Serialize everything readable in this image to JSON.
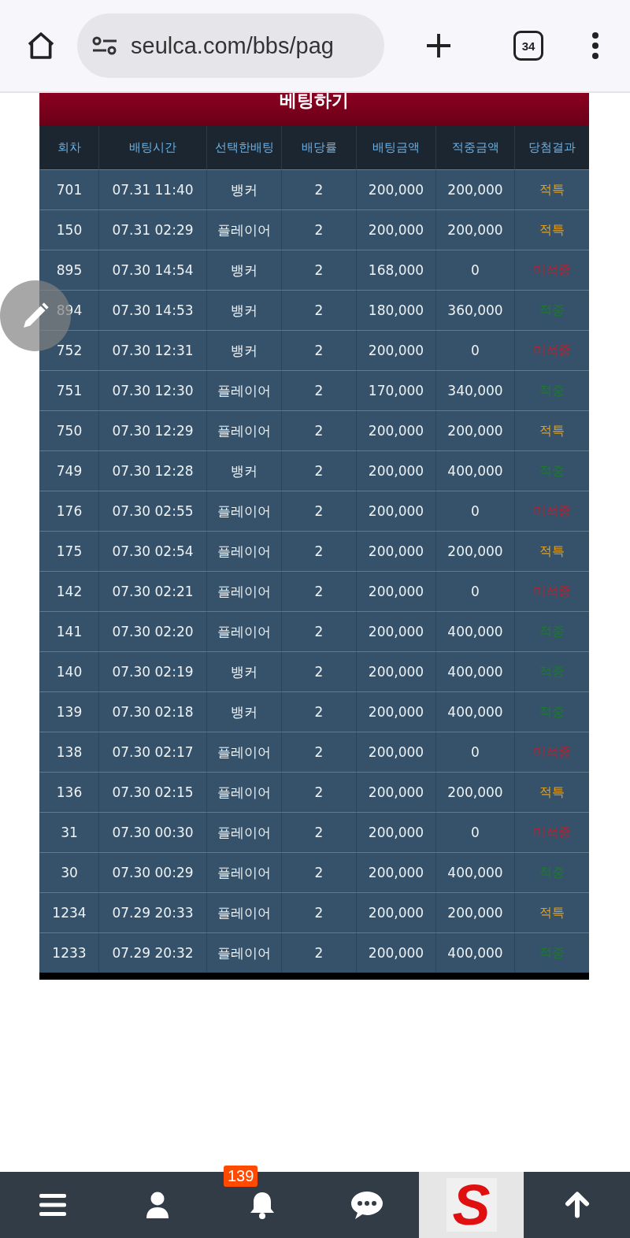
{
  "browser": {
    "url": "seulca.com/bbs/pag",
    "tab_count": "34"
  },
  "table": {
    "title": "베팅하기",
    "columns": [
      "회차",
      "배팅시간",
      "선택한배팅",
      "배당률",
      "배팅금액",
      "적중금액",
      "당첨결과"
    ],
    "rows": [
      {
        "round": "701",
        "time": "07.31 11:40",
        "pick": "뱅커",
        "odds": "2",
        "bet": "200,000",
        "payout": "200,000",
        "result": "적특",
        "color": "#e0a020"
      },
      {
        "round": "150",
        "time": "07.31 02:29",
        "pick": "플레이어",
        "odds": "2",
        "bet": "200,000",
        "payout": "200,000",
        "result": "적특",
        "color": "#e0a020"
      },
      {
        "round": "895",
        "time": "07.30 14:54",
        "pick": "뱅커",
        "odds": "2",
        "bet": "168,000",
        "payout": "0",
        "result": "미적중",
        "color": "#c01f2a"
      },
      {
        "round": "894",
        "time": "07.30 14:53",
        "pick": "뱅커",
        "odds": "2",
        "bet": "180,000",
        "payout": "360,000",
        "result": "적중",
        "color": "#1c7a2c"
      },
      {
        "round": "752",
        "time": "07.30 12:31",
        "pick": "뱅커",
        "odds": "2",
        "bet": "200,000",
        "payout": "0",
        "result": "미적중",
        "color": "#c01f2a"
      },
      {
        "round": "751",
        "time": "07.30 12:30",
        "pick": "플레이어",
        "odds": "2",
        "bet": "170,000",
        "payout": "340,000",
        "result": "적중",
        "color": "#1c7a2c"
      },
      {
        "round": "750",
        "time": "07.30 12:29",
        "pick": "플레이어",
        "odds": "2",
        "bet": "200,000",
        "payout": "200,000",
        "result": "적특",
        "color": "#e0a020"
      },
      {
        "round": "749",
        "time": "07.30 12:28",
        "pick": "뱅커",
        "odds": "2",
        "bet": "200,000",
        "payout": "400,000",
        "result": "적중",
        "color": "#1c7a2c"
      },
      {
        "round": "176",
        "time": "07.30 02:55",
        "pick": "플레이어",
        "odds": "2",
        "bet": "200,000",
        "payout": "0",
        "result": "미적중",
        "color": "#c01f2a"
      },
      {
        "round": "175",
        "time": "07.30 02:54",
        "pick": "플레이어",
        "odds": "2",
        "bet": "200,000",
        "payout": "200,000",
        "result": "적특",
        "color": "#e0a020"
      },
      {
        "round": "142",
        "time": "07.30 02:21",
        "pick": "플레이어",
        "odds": "2",
        "bet": "200,000",
        "payout": "0",
        "result": "미적중",
        "color": "#c01f2a"
      },
      {
        "round": "141",
        "time": "07.30 02:20",
        "pick": "플레이어",
        "odds": "2",
        "bet": "200,000",
        "payout": "400,000",
        "result": "적중",
        "color": "#1c7a2c"
      },
      {
        "round": "140",
        "time": "07.30 02:19",
        "pick": "뱅커",
        "odds": "2",
        "bet": "200,000",
        "payout": "400,000",
        "result": "적중",
        "color": "#1c7a2c"
      },
      {
        "round": "139",
        "time": "07.30 02:18",
        "pick": "뱅커",
        "odds": "2",
        "bet": "200,000",
        "payout": "400,000",
        "result": "적중",
        "color": "#1c7a2c"
      },
      {
        "round": "138",
        "time": "07.30 02:17",
        "pick": "플레이어",
        "odds": "2",
        "bet": "200,000",
        "payout": "0",
        "result": "미적중",
        "color": "#c01f2a"
      },
      {
        "round": "136",
        "time": "07.30 02:15",
        "pick": "플레이어",
        "odds": "2",
        "bet": "200,000",
        "payout": "200,000",
        "result": "적특",
        "color": "#e0a020"
      },
      {
        "round": "31",
        "time": "07.30 00:30",
        "pick": "플레이어",
        "odds": "2",
        "bet": "200,000",
        "payout": "0",
        "result": "미적중",
        "color": "#c01f2a"
      },
      {
        "round": "30",
        "time": "07.30 00:29",
        "pick": "플레이어",
        "odds": "2",
        "bet": "200,000",
        "payout": "400,000",
        "result": "적중",
        "color": "#1c7a2c"
      },
      {
        "round": "1234",
        "time": "07.29 20:33",
        "pick": "플레이어",
        "odds": "2",
        "bet": "200,000",
        "payout": "200,000",
        "result": "적특",
        "color": "#e0a020"
      },
      {
        "round": "1233",
        "time": "07.29 20:32",
        "pick": "플레이어",
        "odds": "2",
        "bet": "200,000",
        "payout": "400,000",
        "result": "적중",
        "color": "#1c7a2c"
      }
    ]
  },
  "bottom_nav": {
    "notification_count": "139",
    "logo_text": "S"
  }
}
